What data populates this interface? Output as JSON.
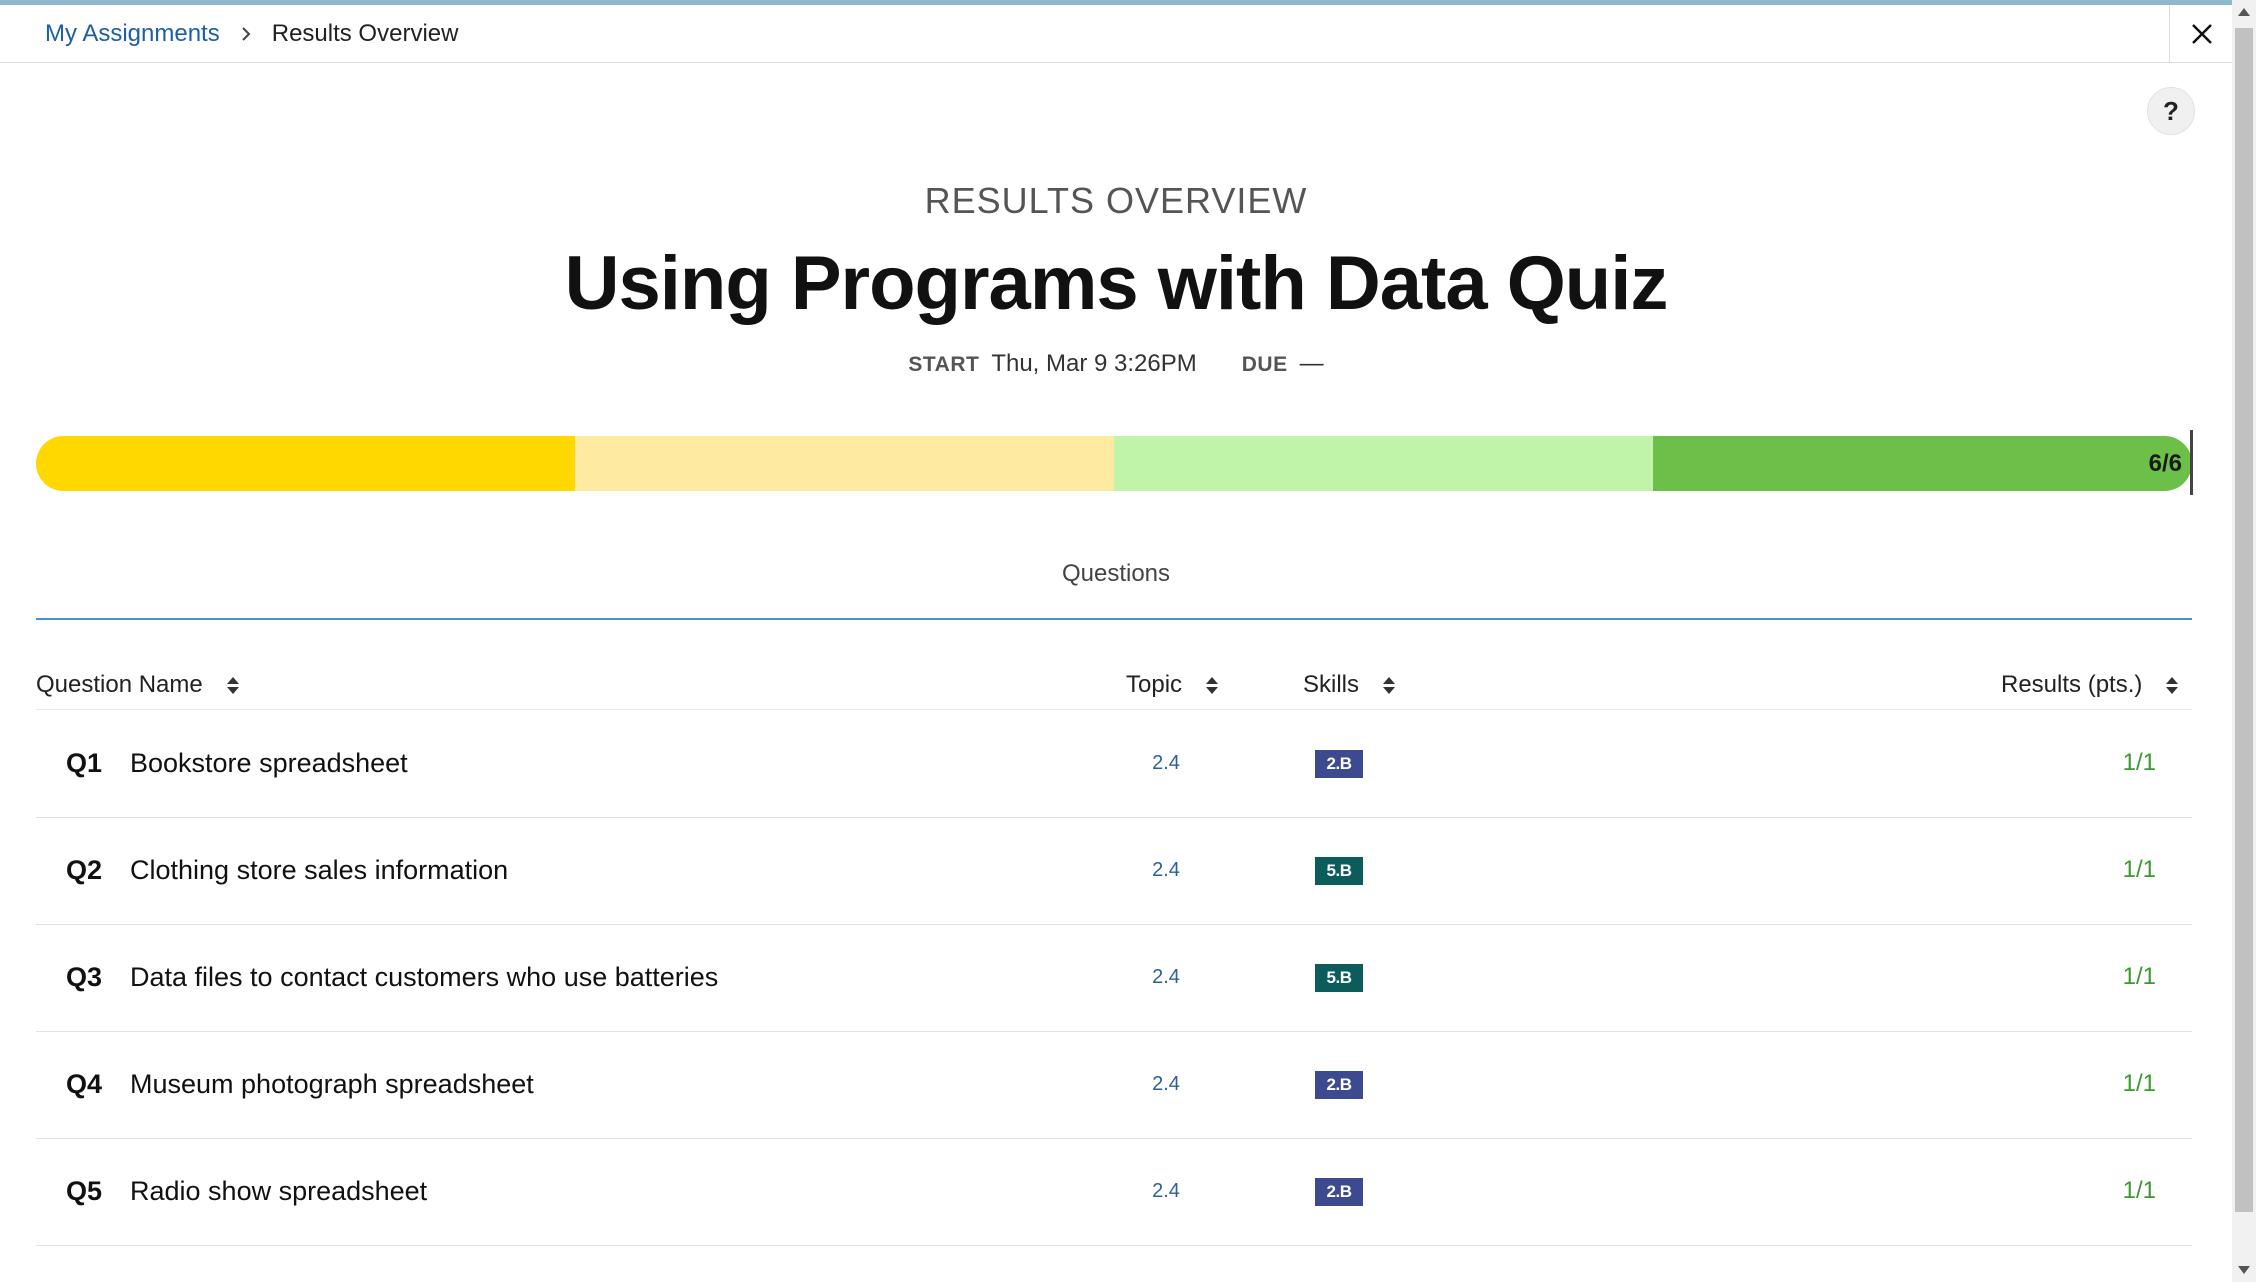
{
  "breadcrumb": {
    "parent": "My Assignments",
    "current": "Results Overview"
  },
  "header": {
    "overview_label": "RESULTS OVERVIEW",
    "title": "Using Programs with Data Quiz",
    "start_label": "START",
    "start_value": "Thu, Mar 9 3:26PM",
    "due_label": "DUE",
    "due_value": "—"
  },
  "help_label": "?",
  "progress": {
    "label": "6/6",
    "score": 6,
    "max": 6,
    "segment_colors": [
      "#ffd800",
      "#feeb9f",
      "#c0f4a8",
      "#6cc04a"
    ]
  },
  "tabs": {
    "questions": "Questions"
  },
  "table": {
    "columns": {
      "question_name": "Question Name",
      "topic": "Topic",
      "skills": "Skills",
      "results": "Results (pts.)"
    },
    "rows": [
      {
        "num": "Q1",
        "name": "Bookstore spreadsheet",
        "topic": "2.4",
        "skill": "2.B",
        "skill_color": "#3d4a8f",
        "result": "1/1"
      },
      {
        "num": "Q2",
        "name": "Clothing store sales information",
        "topic": "2.4",
        "skill": "5.B",
        "skill_color": "#0d5c5c",
        "result": "1/1"
      },
      {
        "num": "Q3",
        "name": "Data files to contact customers who use batteries",
        "topic": "2.4",
        "skill": "5.B",
        "skill_color": "#0d5c5c",
        "result": "1/1"
      },
      {
        "num": "Q4",
        "name": "Museum photograph spreadsheet",
        "topic": "2.4",
        "skill": "2.B",
        "skill_color": "#3d4a8f",
        "result": "1/1"
      },
      {
        "num": "Q5",
        "name": "Radio show spreadsheet",
        "topic": "2.4",
        "skill": "2.B",
        "skill_color": "#3d4a8f",
        "result": "1/1"
      }
    ]
  },
  "colors": {
    "link": "#1c5fa8",
    "result_green": "#3a9a2e",
    "tab_underline": "#4a90c4"
  }
}
